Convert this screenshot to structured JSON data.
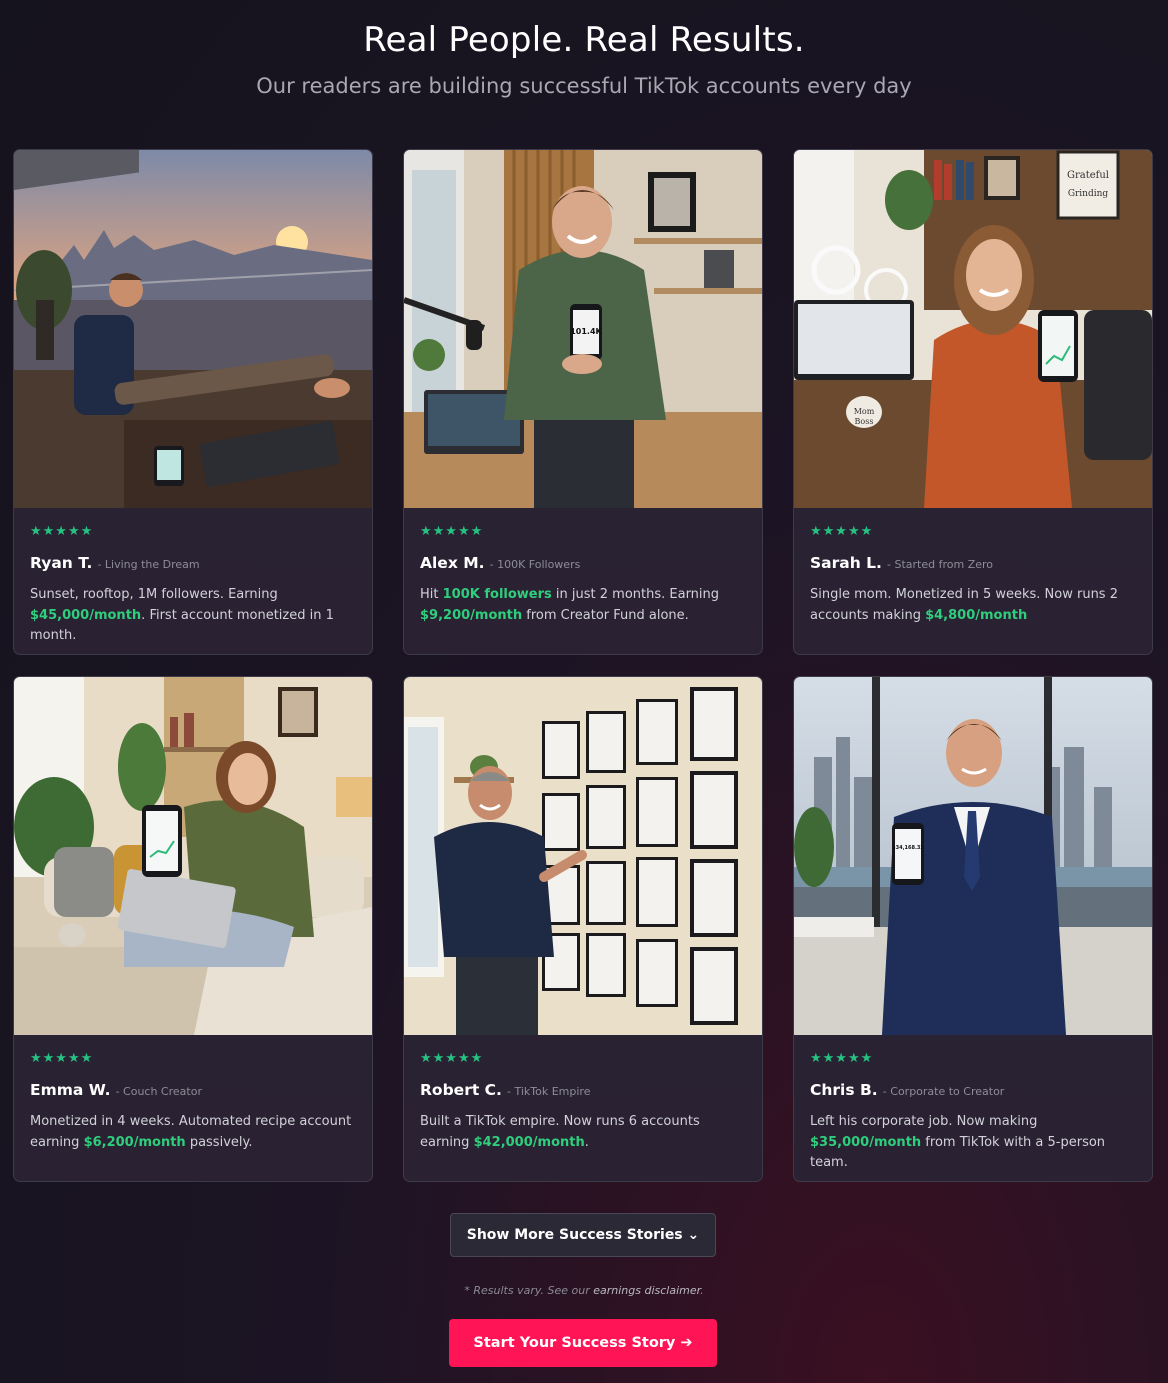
{
  "header": {
    "title": "Real People. Real Results.",
    "subtitle": "Our readers are building successful TikTok accounts every day"
  },
  "cards": [
    {
      "photo_icon": "man-relaxing-on-balcony-image",
      "stars": "★★★★★",
      "name": "Ryan T.",
      "tag": "- Living the Dream",
      "desc": [
        "Sunset, rooftop, 1M followers. Earning ",
        "$45,000/month",
        ".",
        " First account monetized in 1 month."
      ]
    },
    {
      "photo_icon": "man-holding-phone-image",
      "stars": "★★★★★",
      "name": "Alex M.",
      "tag": "- 100K Followers",
      "desc": [
        "Hit ",
        "100K followers",
        " in just 2 months. Earning ",
        "$9,200/month",
        " from Creator Fund alone."
      ]
    },
    {
      "photo_icon": "woman-at-desk-image",
      "stars": "★★★★★",
      "name": "Sarah L.",
      "tag": "- Started from Zero",
      "desc": [
        "Single mom. Monetized in 5 weeks. Now runs 2 accounts making ",
        "$4,800/month"
      ]
    },
    {
      "photo_icon": "woman-on-couch-image",
      "stars": "★★★★★",
      "name": "Emma W.",
      "tag": "- Couch Creator",
      "desc": [
        "Monetized in 4 weeks. Automated recipe account earning ",
        "$6,200/month",
        " passively."
      ]
    },
    {
      "photo_icon": "man-pointing-at-wall-image",
      "stars": "★★★★★",
      "name": "Robert C.",
      "tag": "- TikTok Empire",
      "desc": [
        "Built a TikTok empire. Now runs 6 accounts earning ",
        "$42,000/month",
        "."
      ]
    },
    {
      "photo_icon": "man-in-suit-image",
      "stars": "★★★★★",
      "name": "Chris B.",
      "tag": "- Corporate to Creator",
      "desc": [
        "Left his corporate job. Now making ",
        "$35,000/month",
        " from TikTok with a 5-person team."
      ]
    }
  ],
  "photo_texts": {
    "alex_phone": "101.4K",
    "sarah_sign_1": "Grateful",
    "sarah_sign_2": "Grinding",
    "sarah_mug_1": "Mom",
    "sarah_mug_2": "Boss",
    "chris_phone": "$34,168.32"
  },
  "buttons": {
    "show_more": "Show More Success Stories ⌄",
    "cta": "Start Your Success Story ➔"
  },
  "disclaimer": {
    "prefix": "* Results vary. See our ",
    "link": "earnings disclaimer",
    "suffix": "."
  },
  "colors": {
    "accent_green": "#2fce7d",
    "cta_pink": "#ff1456",
    "background": "#15131d"
  }
}
